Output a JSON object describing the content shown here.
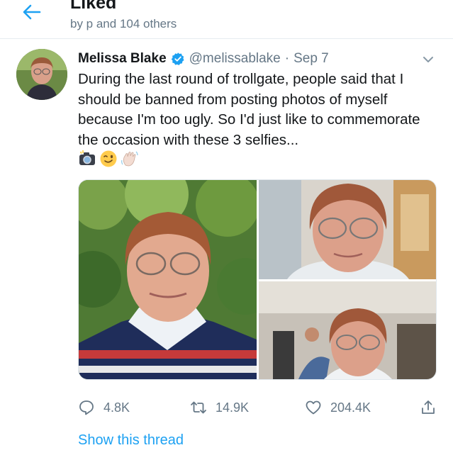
{
  "header": {
    "title": "Liked",
    "subtitle": "by p and 104 others",
    "back_icon": "arrow-left-icon"
  },
  "tweet": {
    "author_name": "Melissa Blake",
    "handle": "@melissablake",
    "separator": "·",
    "date": "Sep 7",
    "verified": true,
    "text": "During the last round of trollgate, people said that I should be banned from posting photos of myself because I'm too ugly. So I'd just like to commemorate the occasion with these 3 selfies...",
    "emojis": [
      "camera-with-flash-emoji",
      "winking-face-emoji",
      "waving-hand-emoji"
    ],
    "photo_count": 3
  },
  "actions": {
    "reply_count": "4.8K",
    "retweet_count": "14.9K",
    "like_count": "204.4K"
  },
  "show_thread_label": "Show this thread",
  "colors": {
    "accent": "#1da1f2",
    "text": "#14171a",
    "muted": "#657786",
    "border": "#e6ecf0"
  }
}
